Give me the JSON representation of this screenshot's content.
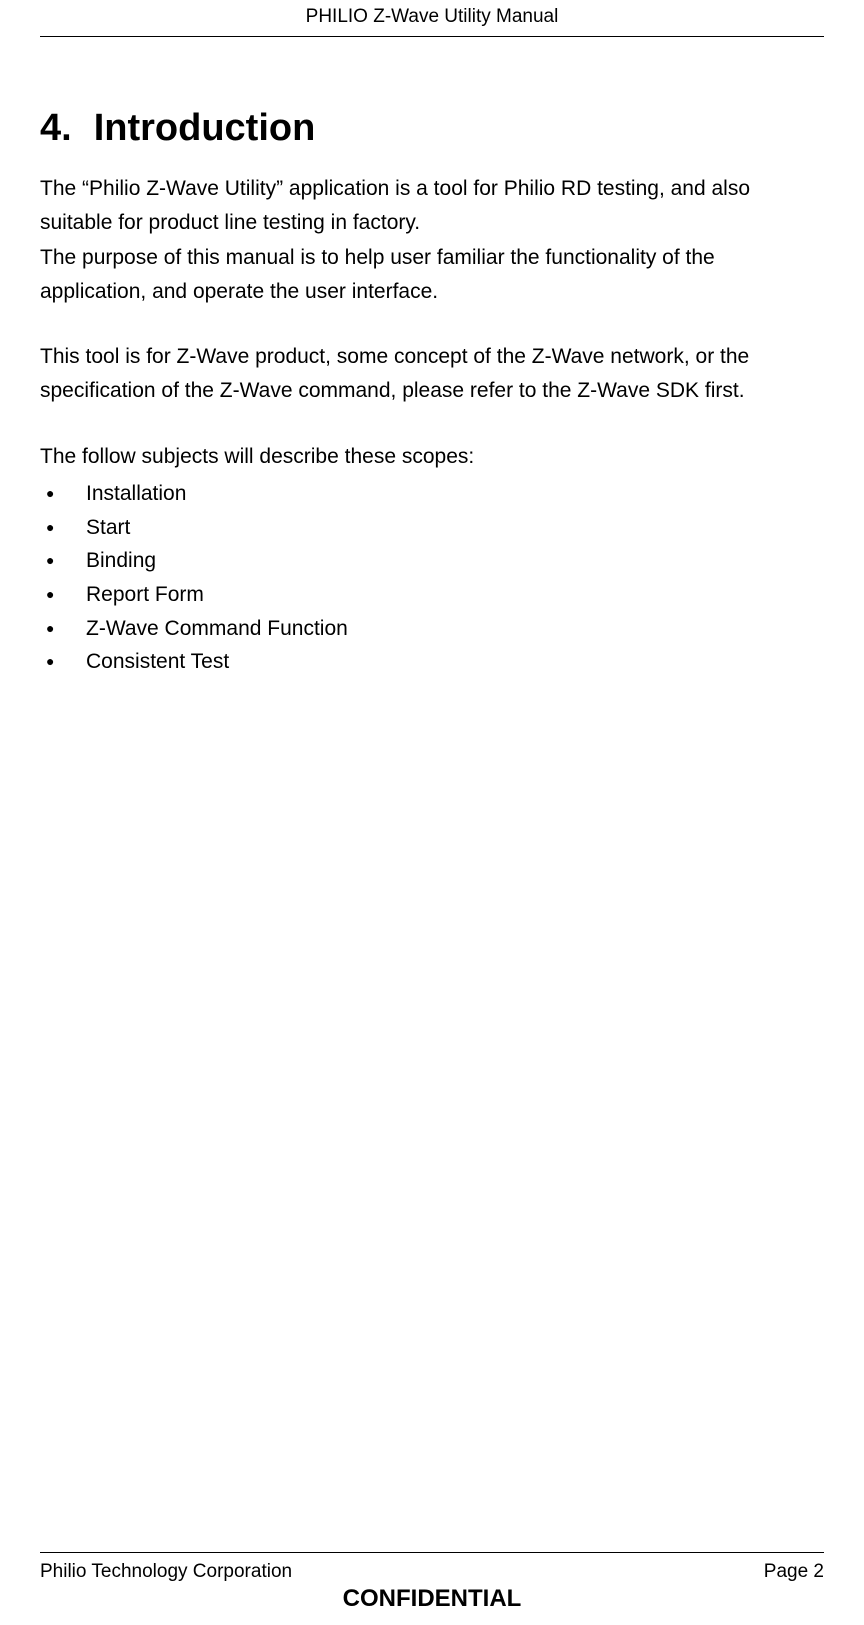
{
  "header": {
    "title": "PHILIO Z-Wave Utility Manual"
  },
  "section": {
    "number": "4.",
    "title": "Introduction"
  },
  "paragraphs": {
    "p1": "The “Philio Z-Wave Utility” application is a tool for Philio RD testing, and also suitable for product line testing in factory.",
    "p2": "The purpose of this manual is to help user familiar the functionality of the application, and operate the user interface.",
    "p3": "This tool is for Z-Wave product, some concept of the Z-Wave network, or the specification of the Z-Wave command, please refer to the Z-Wave SDK first.",
    "p4": "The follow subjects will describe these scopes:"
  },
  "scopes": [
    "Installation",
    "Start",
    "Binding",
    "Report Form",
    "Z-Wave Command Function",
    "Consistent Test"
  ],
  "footer": {
    "company": "Philio Technology Corporation",
    "page_label": "Page 2",
    "confidential": "CONFIDENTIAL"
  }
}
